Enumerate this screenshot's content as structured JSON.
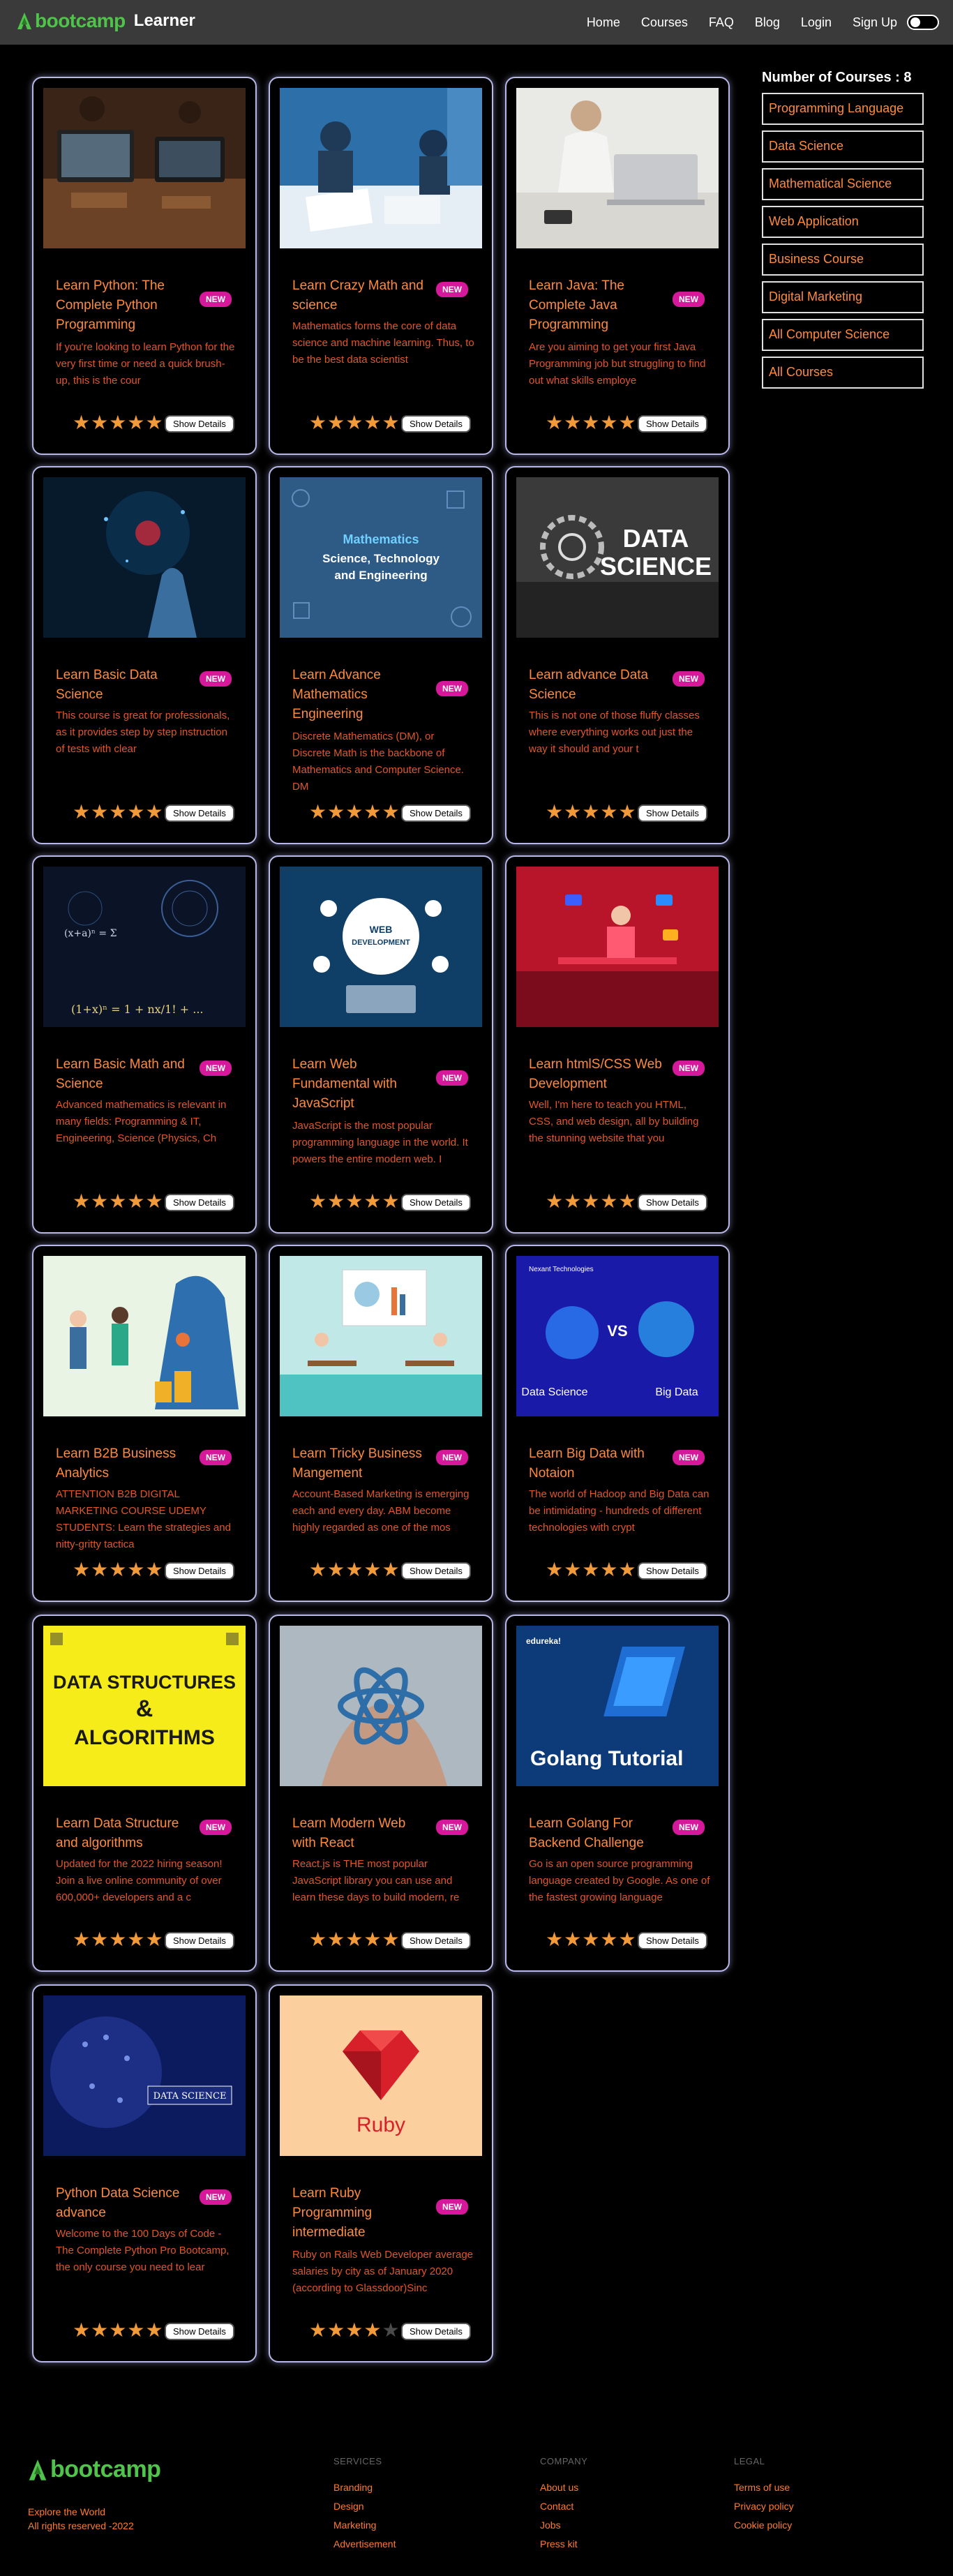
{
  "nav": {
    "brand": "bootcamp",
    "subtitle": "Learner",
    "links": [
      "Home",
      "Courses",
      "FAQ",
      "Blog",
      "Login",
      "Sign Up"
    ],
    "accent": "#4fc34a"
  },
  "sidebar": {
    "title": "Number of Courses : 8",
    "categories": [
      "Programming Language",
      "Data Science",
      "Mathematical Science",
      "Web Application",
      "Business Course",
      "Digital Marketing",
      "All Computer Science",
      "All Courses"
    ]
  },
  "show_details_label": "Show Details",
  "new_label": "NEW",
  "courses": [
    {
      "title": "Learn Python: The Complete Python Programming",
      "desc": "If you're looking to learn Python for the very first time or need a quick brush-up, this is the cour",
      "rating": 5
    },
    {
      "title": "Learn Crazy Math and science",
      "desc": "Mathematics forms the core of data science and machine learning. Thus, to be the best data scientist",
      "rating": 5
    },
    {
      "title": "Learn Java: The Complete Java Programming",
      "desc": "Are you aiming to get your first Java Programming job but struggling to find out what skills employe",
      "rating": 5
    },
    {
      "title": "Learn Basic Data Science",
      "desc": "This course is great for professionals, as it provides step by step instruction of tests with clear",
      "rating": 5
    },
    {
      "title": "Learn Advance Mathematics Engineering",
      "desc": "Discrete Mathematics (DM), or Discrete Math is the backbone of Mathematics and Computer Science. DM",
      "rating": 5
    },
    {
      "title": "Learn advance Data Science",
      "desc": "This is not one of those fluffy classes where everything works out just the way it should and your t",
      "rating": 5
    },
    {
      "title": "Learn Basic Math and Science",
      "desc": "Advanced mathematics is relevant in many fields: Programming & IT, Engineering, Science (Physics, Ch",
      "rating": 5
    },
    {
      "title": "Learn Web Fundamental with JavaScript",
      "desc": "JavaScript is the most popular programming language in the world. It powers the entire modern web. I",
      "rating": 5
    },
    {
      "title": "Learn htmlS/CSS Web Development",
      "desc": "Well, I'm here to teach you HTML, CSS, and web design, all by building the stunning website that you",
      "rating": 5
    },
    {
      "title": "Learn B2B Business Analytics",
      "desc": "ATTENTION B2B DIGITAL MARKETING COURSE UDEMY STUDENTS: Learn the strategies and nitty-gritty tactica",
      "rating": 5
    },
    {
      "title": "Learn Tricky Business Mangement",
      "desc": "Account-Based Marketing is emerging each and every day. ABM become highly regarded as one of the mos",
      "rating": 5
    },
    {
      "title": "Learn Big Data with Notaion",
      "desc": "The world of Hadoop and Big Data can be intimidating - hundreds of different technologies with crypt",
      "rating": 5
    },
    {
      "title": "Learn Data Structure and algorithms",
      "desc": "Updated for the 2022 hiring season! Join a live online community of over 600,000+ developers and a c",
      "rating": 5
    },
    {
      "title": "Learn Modern Web with React",
      "desc": "React.js is THE most popular JavaScript library you can use and learn these days to build modern, re",
      "rating": 5
    },
    {
      "title": "Learn Golang For Backend Challenge",
      "desc": "Go is an open source programming language created by Google. As one of the fastest growing language",
      "rating": 5
    },
    {
      "title": "Python Data Science advance",
      "desc": "Welcome to the 100 Days of Code - The Complete Python Pro Bootcamp, the only course you need to lear",
      "rating": 5
    },
    {
      "title": "Learn Ruby Programming intermediate",
      "desc": "Ruby on Rails Web Developer average salaries by city as of January 2020 (according to Glassdoor)Sinc",
      "rating": 4
    }
  ],
  "image_text": {
    "math_poster": [
      "Mathematics",
      "Science, Technology",
      "and Engineering"
    ],
    "data_science": [
      "DATA",
      "SCIENCE"
    ],
    "web_dev": [
      "WEB",
      "DEVELOPMENT"
    ],
    "bigdata_header": "Nexant Technologies",
    "bigdata_left": "Data Science",
    "bigdata_vs": "VS",
    "bigdata_right": "Big Data",
    "dsa": [
      "DATA STRUCTURES",
      "&",
      "ALGORITHMS"
    ],
    "golang_brand": "edureka!",
    "golang_title": "Golang Tutorial",
    "pyds_label": "DATA SCIENCE",
    "ruby_label": "Ruby"
  },
  "footer": {
    "brand": "bootcamp",
    "tagline": [
      "Explore the World",
      "All rights reserved -2022"
    ],
    "columns": [
      {
        "title": "SERVICES",
        "links": [
          "Branding",
          "Design",
          "Marketing",
          "Advertisement"
        ]
      },
      {
        "title": "COMPANY",
        "links": [
          "About us",
          "Contact",
          "Jobs",
          "Press kit"
        ]
      },
      {
        "title": "LEGAL",
        "links": [
          "Terms of use",
          "Privacy policy",
          "Cookie policy"
        ]
      }
    ]
  }
}
